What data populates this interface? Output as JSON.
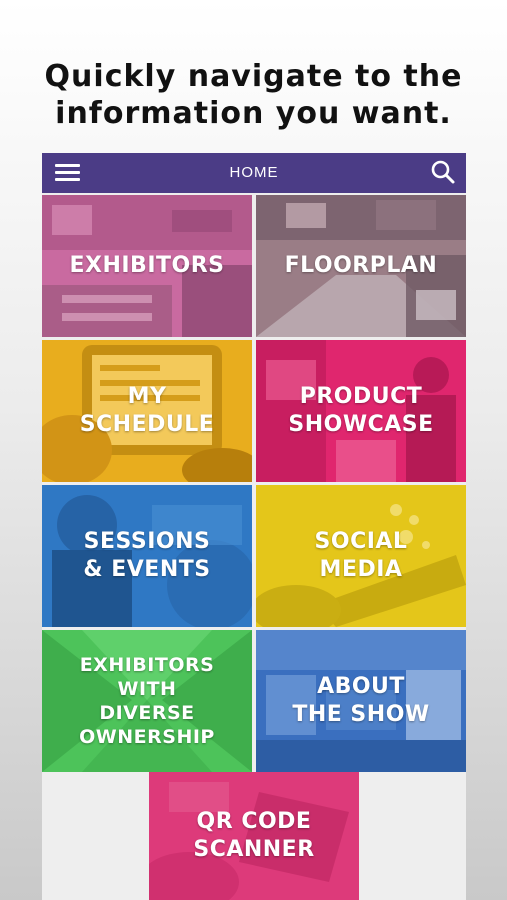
{
  "headline": {
    "line1": "Quickly navigate to the",
    "line2": "information you want."
  },
  "appbar": {
    "title": "HOME",
    "menu_icon": "hamburger-menu-icon",
    "search_icon": "search-icon",
    "background": "#4b3c86"
  },
  "tiles": [
    {
      "label": "EXHIBITORS",
      "color": "#c96aa0"
    },
    {
      "label": "FLOORPLAN",
      "color": "#9a7d86"
    },
    {
      "label": "MY\nSCHEDULE",
      "color": "#e8ad1e"
    },
    {
      "label": "PRODUCT\nSHOWCASE",
      "color": "#e0266e"
    },
    {
      "label": "SESSIONS\n& EVENTS",
      "color": "#2f78c4"
    },
    {
      "label": "SOCIAL\nMEDIA",
      "color": "#e4c61a"
    },
    {
      "label": "EXHIBITORS\nWITH\nDIVERSE\nOWNERSHIP",
      "color": "#4dc35a"
    },
    {
      "label": "ABOUT\nTHE SHOW",
      "color": "#3a6fbf"
    }
  ],
  "qr_tile": {
    "label": "QR CODE\nSCANNER",
    "color": "#dd3a7a"
  }
}
